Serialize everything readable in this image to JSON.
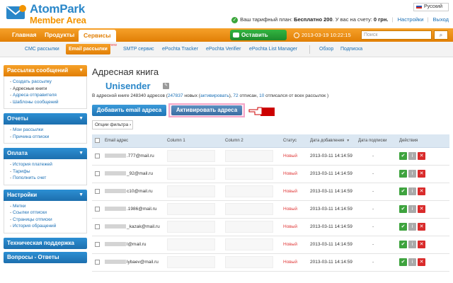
{
  "header": {
    "logo_line1": "AtomPark",
    "logo_line2": "Member Area",
    "language": "Русский",
    "plan_prefix": "Ваш тарифный план:",
    "plan_value": "Бесплатно 200",
    "balance_prefix": ". У вас на счету:",
    "balance_value": "0 грн.",
    "settings_link": "Настройки",
    "logout_link": "Выход"
  },
  "nav": {
    "items": [
      "Главная",
      "Продукты",
      "Сервисы"
    ],
    "active": "Сервисы",
    "feedback_label": "Оставить отзыв",
    "datetime": "2013-03-19 10:22:15",
    "search_placeholder": "Поиск"
  },
  "subnav": {
    "items": [
      "СМС рассылки",
      "Email рассылки",
      "SMTP сервис",
      "ePochta Tracker",
      "ePochta Verifier",
      "ePochta List Manager",
      "Обзор",
      "Подписка"
    ],
    "new_tag": "new"
  },
  "sidebar": {
    "blocks": [
      {
        "title": "Рассылка сообщений",
        "items": [
          "Создать рассылку",
          "Адресные книги",
          "Адреса отправителя",
          "Шаблоны сообщений"
        ]
      },
      {
        "title": "Отчеты",
        "items": [
          "Мои рассылки",
          "Причина отписки"
        ]
      },
      {
        "title": "Оплата",
        "items": [
          "История платежей",
          "Тарифы",
          "Пополнить счет"
        ]
      },
      {
        "title": "Настройки",
        "items": [
          "Метки",
          "Ссылки отписки",
          "Страницы отписки",
          "История обращений"
        ]
      }
    ],
    "plain": [
      "Техническая поддержка",
      "Вопросы - Ответы"
    ]
  },
  "main": {
    "title": "Адресная книга",
    "book_name": "Unisender",
    "info_prefix": "В адресной книге 248340 адресов (",
    "info_new_count": "247837",
    "info_new_text": " новых (",
    "info_activate_link": "активировать",
    "info_mid": "), ",
    "info_unsub_count": "72",
    "info_unsub_text": " отписан, ",
    "info_unsub_all_count": "10",
    "info_tail": " отписался от всех рассылок )",
    "add_button": "Добавить email адреса",
    "activate_button": "Активировать адреса",
    "filter_button": "Опции фильтра ›"
  },
  "table": {
    "headers": [
      "Email адрес",
      "Column 1",
      "Column 2",
      "Статус",
      "Дата добавления",
      "Дата подписки",
      "Действия"
    ],
    "rows": [
      {
        "email": ".777@mail.ru",
        "status": "Новый",
        "date": "2013-03-11 14:14:59",
        "sub": "-"
      },
      {
        "email": "_92@mail.ru",
        "status": "Новый",
        "date": "2013-03-11 14:14:59",
        "sub": "-"
      },
      {
        "email": "c10@mail.ru",
        "status": "Новый",
        "date": "2013-03-11 14:14:59",
        "sub": "-"
      },
      {
        "email": ".1986@mail.ru",
        "status": "Новый",
        "date": "2013-03-11 14:14:59",
        "sub": "-"
      },
      {
        "email": "_kazak@mail.ru",
        "status": "Новый",
        "date": "2013-03-11 14:14:59",
        "sub": "-"
      },
      {
        "email": "l@mail.ru",
        "status": "Новый",
        "date": "2013-03-11 14:14:59",
        "sub": "-"
      },
      {
        "email": "lybaev@mail.ru",
        "status": "Новый",
        "date": "2013-03-11 14:14:59",
        "sub": "-"
      }
    ]
  }
}
